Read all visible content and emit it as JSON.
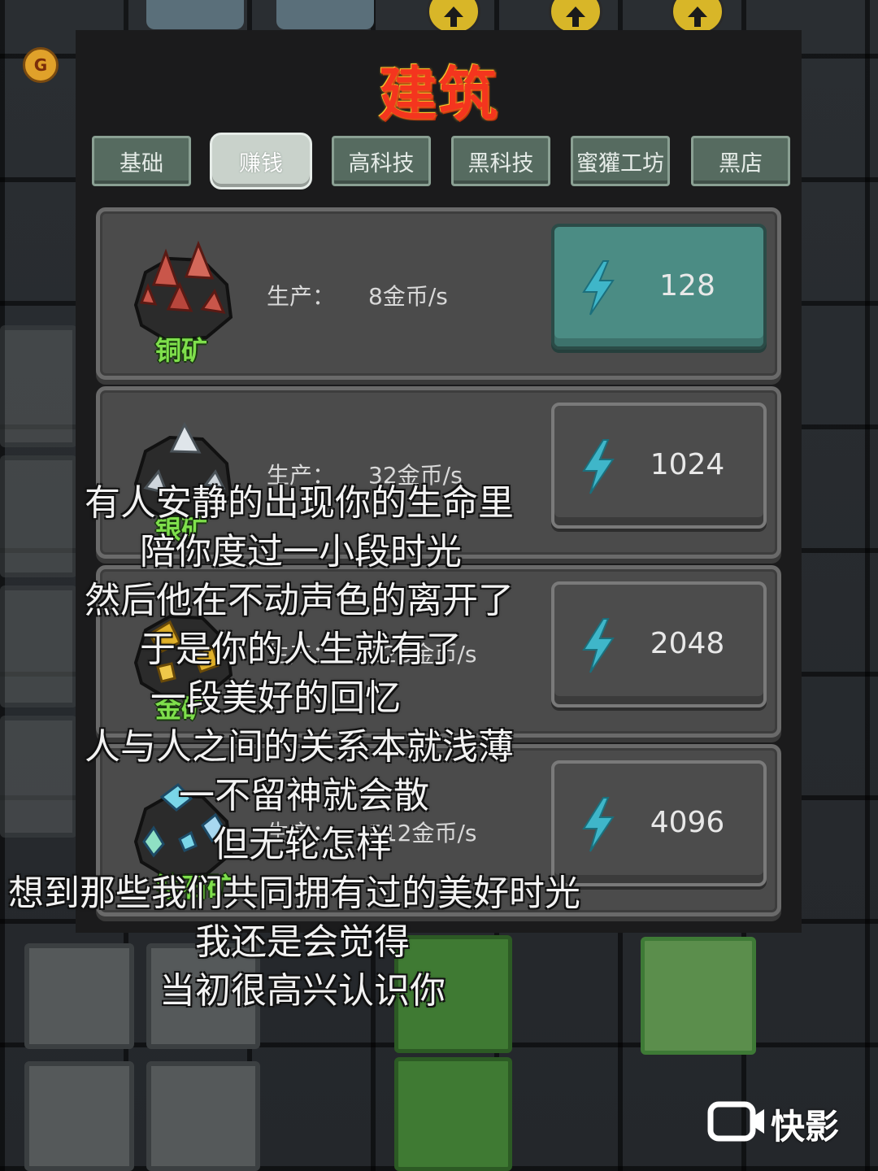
{
  "panel": {
    "title": "建筑",
    "tabs": [
      {
        "label": "基础",
        "active": false
      },
      {
        "label": "赚钱",
        "active": true
      },
      {
        "label": "高科技",
        "active": false
      },
      {
        "label": "黑科技",
        "active": false
      },
      {
        "label": "蜜獾工坊",
        "active": false
      },
      {
        "label": "黑店",
        "active": false
      }
    ],
    "buildings": [
      {
        "name": "铜矿",
        "production_label": "生产：",
        "production_value": "8金币/s",
        "cost": "128",
        "cost_icon": "lightning-icon",
        "affordable": true,
        "ore_color": "#c9564a"
      },
      {
        "name": "银矿",
        "production_label": "生产：",
        "production_value": "32金币/s",
        "cost": "1024",
        "cost_icon": "lightning-icon",
        "affordable": false,
        "ore_color": "#cfd6dc"
      },
      {
        "name": "金矿",
        "production_label": "生产：",
        "production_value": "128金币/s",
        "cost": "2048",
        "cost_icon": "lightning-icon",
        "affordable": false,
        "ore_color": "#e2b22a"
      },
      {
        "name": "钻石矿",
        "production_label": "生产：",
        "production_value": "512金币/s",
        "cost": "4096",
        "cost_icon": "lightning-icon",
        "affordable": false,
        "ore_color": "#7ad6e8"
      }
    ]
  },
  "hud": {
    "coin_badge": "G"
  },
  "subtitles": [
    "有人安静的出现你的生命里",
    "陪你度过一小段时光",
    "然后他在不动声色的离开了",
    "于是你的人生就有了",
    "一段美好的回忆",
    "人与人之间的关系本就浅薄",
    "一不留神就会散",
    "但无轮怎样",
    "想到那些我们共同拥有过的美好时光",
    "我还是会觉得",
    "当初很高兴认识你"
  ],
  "watermark": {
    "text": "快影",
    "icon": "camera-icon"
  },
  "colors": {
    "title": "#f4351e",
    "tab": "#566b60",
    "tab_active": "#c9d2cb",
    "button_active": "#4b8c84",
    "bolt": "#3fb6c9",
    "ore_label": "#7fe04c"
  }
}
